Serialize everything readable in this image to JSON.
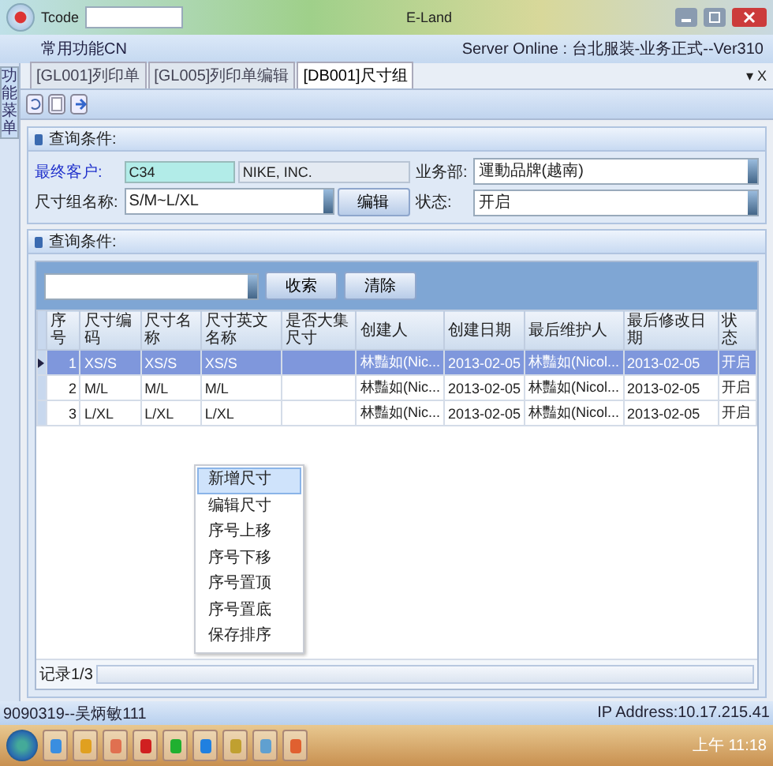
{
  "window": {
    "title": "E-Land",
    "tcode_label": "Tcode"
  },
  "ribbon": {
    "menu": "常用功能CN",
    "server": "Server Online : 台北服装-业务正式--Ver310",
    "close": "▾ X"
  },
  "sidebar_tab": "功能菜单",
  "tabs": [
    {
      "label": "[GL001]列印单",
      "selected": false
    },
    {
      "label": "[GL005]列印单编辑",
      "selected": false
    },
    {
      "label": "[DB001]尺寸组",
      "selected": true
    }
  ],
  "query": {
    "title": "查询条件:",
    "customer_label": "最终客户:",
    "customer_code": "C34",
    "customer_name": "NIKE, INC.",
    "dept_label": "业务部:",
    "dept": "運動品牌(越南)",
    "group_label": "尺寸组名称:",
    "group": "S/M~L/XL",
    "edit_button": "编辑",
    "status_label": "状态:",
    "status": "开启"
  },
  "results": {
    "title": "查询条件:",
    "search_button": "收索",
    "clear_button": "清除",
    "record": "记录1/3"
  },
  "table": {
    "columns": [
      "序号",
      "尺寸编码",
      "尺寸名称",
      "尺寸英文名称",
      "是否大集尺寸",
      "创建人",
      "创建日期",
      "最后维护人",
      "最后修改日期",
      "状态"
    ],
    "rows": [
      {
        "selected": true,
        "cells": [
          "1",
          "XS/S",
          "XS/S",
          "XS/S",
          "",
          "林豔如(Nic...",
          "2013-02-05",
          "林豔如(Nicol...",
          "2013-02-05",
          "开启"
        ]
      },
      {
        "selected": false,
        "cells": [
          "2",
          "M/L",
          "M/L",
          "M/L",
          "",
          "林豔如(Nic...",
          "2013-02-05",
          "林豔如(Nicol...",
          "2013-02-05",
          "开启"
        ]
      },
      {
        "selected": false,
        "cells": [
          "3",
          "L/XL",
          "L/XL",
          "L/XL",
          "",
          "林豔如(Nic...",
          "2013-02-05",
          "林豔如(Nicol...",
          "2013-02-05",
          "开启"
        ]
      }
    ]
  },
  "context_menu": [
    {
      "label": "新增尺寸",
      "selected": true
    },
    {
      "label": "编辑尺寸",
      "selected": false
    },
    {
      "label": "序号上移",
      "selected": false
    },
    {
      "label": "序号下移",
      "selected": false
    },
    {
      "label": "序号置顶",
      "selected": false
    },
    {
      "label": "序号置底",
      "selected": false
    },
    {
      "label": "保存排序",
      "selected": false
    }
  ],
  "status_bar": {
    "user": "9090319--吴炳敏111",
    "ip": "IP Address:10.17.215.41"
  },
  "taskbar": {
    "clock": "上午 11:18"
  }
}
